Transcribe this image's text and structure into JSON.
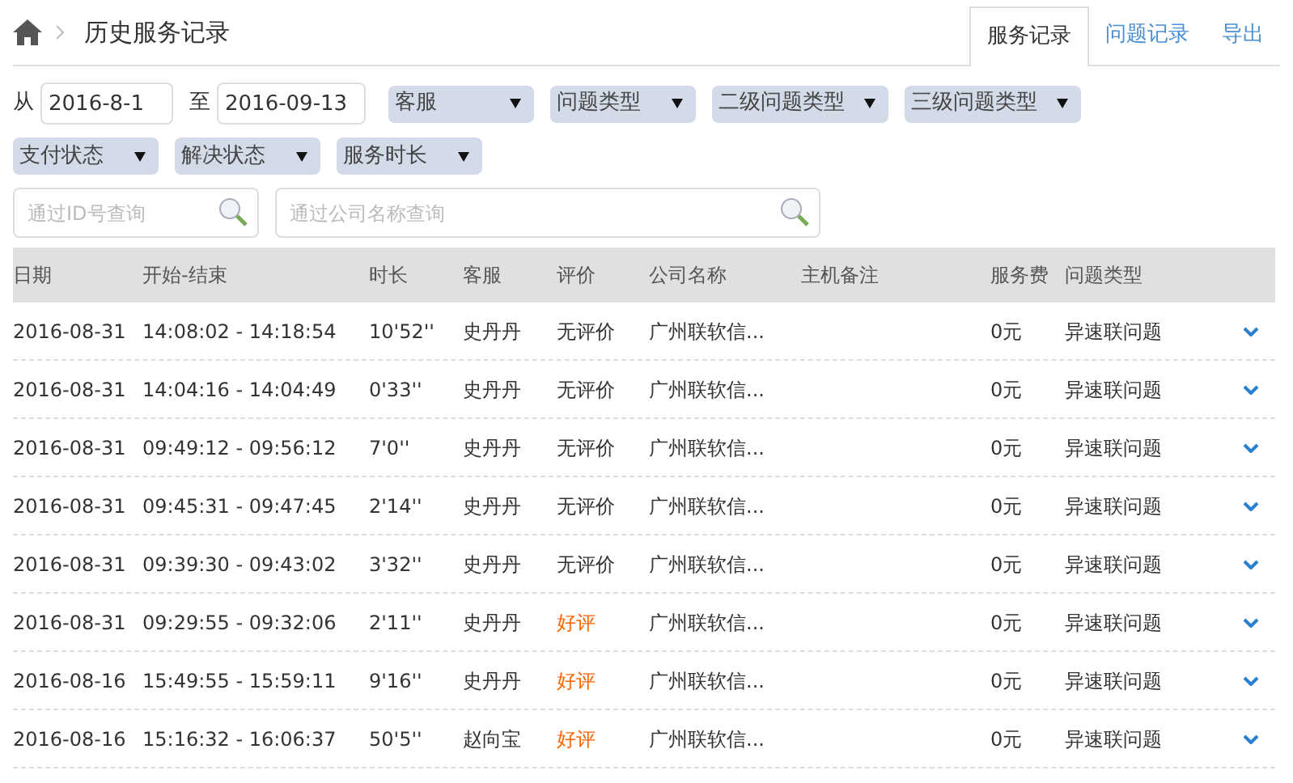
{
  "breadcrumb": {
    "title": "历史服务记录"
  },
  "tabs": [
    {
      "label": "服务记录",
      "selected": true
    },
    {
      "label": "问题记录",
      "selected": false
    },
    {
      "label": "导出",
      "selected": false
    }
  ],
  "date_range": {
    "from_label": "从",
    "from": "2016-8-1",
    "to_label": "至",
    "to": "2016-09-13"
  },
  "filters_row_1": [
    "客服",
    "问题类型",
    "二级问题类型",
    "三级问题类型"
  ],
  "filters_row_2": [
    "支付状态",
    "解决状态",
    "服务时长"
  ],
  "search_id": {
    "placeholder": "通过ID号查询"
  },
  "search_company": {
    "placeholder": "通过公司名称查询"
  },
  "table": {
    "columns": [
      "日期",
      "开始-结束",
      "时长",
      "客服",
      "评价",
      "公司名称",
      "主机备注",
      "服务费",
      "问题类型"
    ],
    "rows": [
      {
        "date": "2016-08-31",
        "time": "14:08:02 - 14:18:54",
        "duration": "10'52''",
        "agent": "史丹丹",
        "rating": "无评价",
        "color": "#333333",
        "company": "广州联软信...",
        "fee": "0元",
        "type": "异速联问题"
      },
      {
        "date": "2016-08-31",
        "time": "14:04:16 - 14:04:49",
        "duration": "0'33''",
        "agent": "史丹丹",
        "rating": "无评价",
        "color": "#333333",
        "company": "广州联软信...",
        "fee": "0元",
        "type": "异速联问题"
      },
      {
        "date": "2016-08-31",
        "time": "09:49:12 - 09:56:12",
        "duration": "7'0''",
        "agent": "史丹丹",
        "rating": "无评价",
        "color": "#333333",
        "company": "广州联软信...",
        "fee": "0元",
        "type": "异速联问题"
      },
      {
        "date": "2016-08-31",
        "time": "09:45:31 - 09:47:45",
        "duration": "2'14''",
        "agent": "史丹丹",
        "rating": "无评价",
        "color": "#333333",
        "company": "广州联软信...",
        "fee": "0元",
        "type": "异速联问题"
      },
      {
        "date": "2016-08-31",
        "time": "09:39:30 - 09:43:02",
        "duration": "3'32''",
        "agent": "史丹丹",
        "rating": "无评价",
        "color": "#333333",
        "company": "广州联软信...",
        "fee": "0元",
        "type": "异速联问题"
      },
      {
        "date": "2016-08-31",
        "time": "09:29:55 - 09:32:06",
        "duration": "2'11''",
        "agent": "史丹丹",
        "rating": "好评",
        "color": "#ff6600",
        "company": "广州联软信...",
        "fee": "0元",
        "type": "异速联问题"
      },
      {
        "date": "2016-08-16",
        "time": "15:49:55 - 15:59:11",
        "duration": "9'16''",
        "agent": "史丹丹",
        "rating": "好评",
        "color": "#ff6600",
        "company": "广州联软信...",
        "fee": "0元",
        "type": "异速联问题"
      },
      {
        "date": "2016-08-16",
        "time": "15:16:32 - 16:06:37",
        "duration": "50'5''",
        "agent": "赵向宝",
        "rating": "好评",
        "color": "#ff6600",
        "company": "广州联软信...",
        "fee": "0元",
        "type": "异速联问题"
      }
    ]
  }
}
